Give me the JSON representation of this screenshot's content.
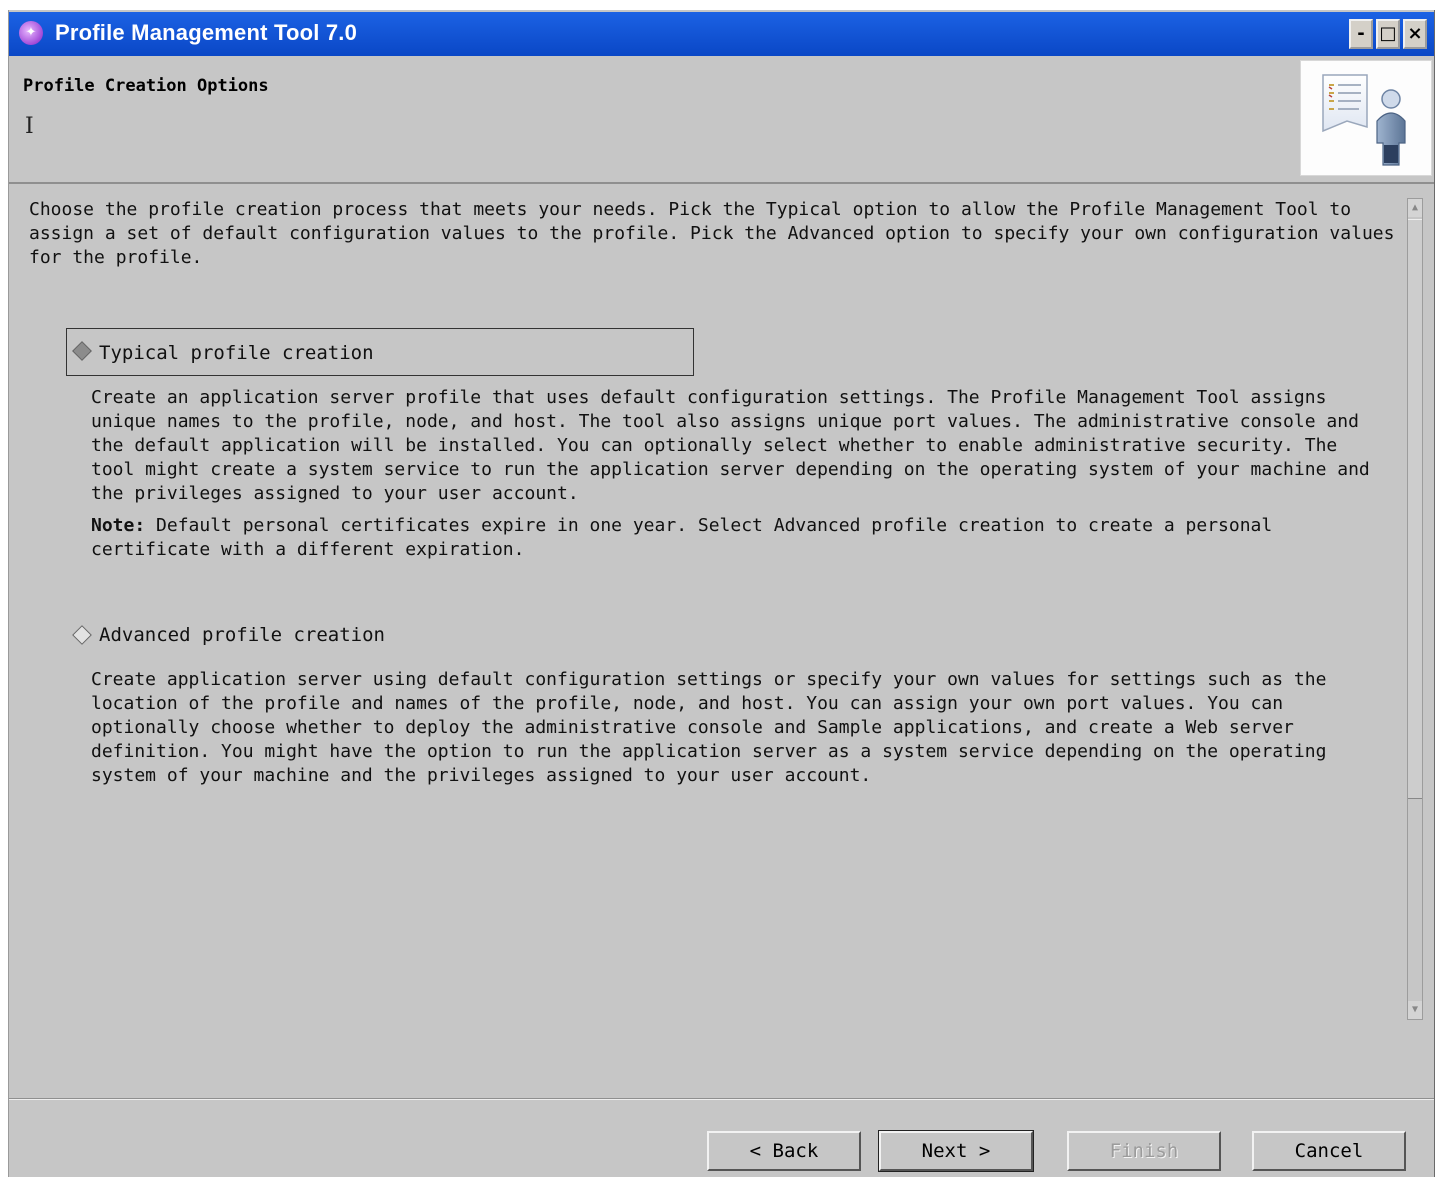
{
  "window": {
    "title": "Profile Management Tool 7.0",
    "controls": {
      "minimize": "-",
      "maximize": "□",
      "close": "×"
    }
  },
  "header": {
    "title": "Profile Creation Options",
    "cursor_glyph": "I",
    "banner_icon": "profile-document-person-icon"
  },
  "main": {
    "intro": "Choose the profile creation process that meets your needs. Pick the Typical option to allow the Profile Management Tool to assign a set of default configuration values to the profile. Pick the Advanced option to specify your own configuration values for the profile.",
    "options": [
      {
        "label": "Typical profile creation",
        "selected": true,
        "description": "Create an application server profile that uses default configuration settings. The Profile Management Tool assigns unique names to the profile, node, and host. The tool also assigns unique port values. The administrative console and the default application will be installed. You can optionally select whether to enable administrative security. The tool might create a system service to run the application server depending on the operating system of your machine and the privileges assigned to your user account.",
        "note_label": "Note:",
        "note_text": " Default personal certificates expire in one year.  Select Advanced profile creation to create a personal certificate with a different expiration."
      },
      {
        "label": "Advanced profile creation",
        "selected": false,
        "description": "Create application server using default configuration settings or specify your own values for settings such as the location of the profile and names of the profile, node, and host. You can assign your own port values. You can optionally choose whether to deploy the administrative console and Sample applications, and create a Web server definition. You might have the option to run the application server as a system service depending on the operating system of your machine and the privileges assigned to your user account."
      }
    ]
  },
  "footer": {
    "back": "< Back",
    "next": "Next >",
    "finish": "Finish",
    "cancel": "Cancel"
  }
}
